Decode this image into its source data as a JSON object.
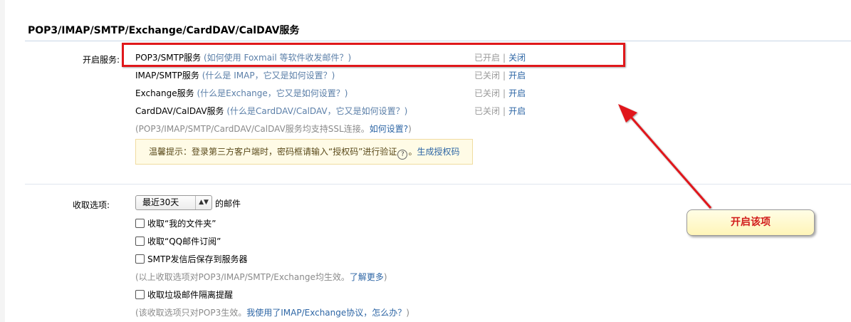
{
  "section": {
    "title": "POP3/IMAP/SMTP/Exchange/CardDAV/CalDAV服务"
  },
  "services": {
    "label": "开启服务:",
    "items": [
      {
        "name": "POP3/SMTP服务",
        "help": "(如何使用 Foxmail 等软件收发邮件？)",
        "state": "已开启",
        "action": "关闭"
      },
      {
        "name": "IMAP/SMTP服务",
        "help": "(什么是 IMAP，它又是如何设置？)",
        "state": "已关闭",
        "action": "开启"
      },
      {
        "name": "Exchange服务",
        "help": "(什么是Exchange，它又是如何设置？)",
        "state": "已关闭",
        "action": "开启"
      },
      {
        "name": "CardDAV/CalDAV服务",
        "help": "(什么是CardDAV/CalDAV，它又是如何设置？)",
        "state": "已关闭",
        "action": "开启"
      }
    ],
    "separator": "|",
    "ssl_note": "(POP3/IMAP/SMTP/CardDAV/CalDAV服务均支持SSL连接。",
    "ssl_link": "如何设置?",
    "ssl_close": ")",
    "tip_text": "温馨提示：登录第三方客户端时，密码框请输入“授权码”进行验证",
    "tip_icon": "question-circle-icon",
    "tip_tail": "。",
    "tip_link": "生成授权码"
  },
  "receive": {
    "label": "收取选项:",
    "range_value": "最近30天",
    "range_suffix": "的邮件",
    "checkboxes": [
      {
        "label": "收取“我的文件夹”",
        "checked": false
      },
      {
        "label": "收取“QQ邮件订阅”",
        "checked": false
      },
      {
        "label": "SMTP发信后保存到服务器",
        "checked": false
      }
    ],
    "note1": "(以上收取选项对POP3/IMAP/SMTP/Exchange均生效。",
    "note1_link": "了解更多",
    "note1_close": ")",
    "junk_checkbox": {
      "label": "收取垃圾邮件隔离提醒",
      "checked": false
    },
    "note2": "(该收取选项只对POP3生效。",
    "note2_link": "我使用了IMAP/Exchange协议，怎么办？",
    "note2_close": ")"
  },
  "annotation": {
    "callout_text": "开启该项",
    "highlight_color": "#e0181b",
    "arrow_color": "#e0181b"
  }
}
